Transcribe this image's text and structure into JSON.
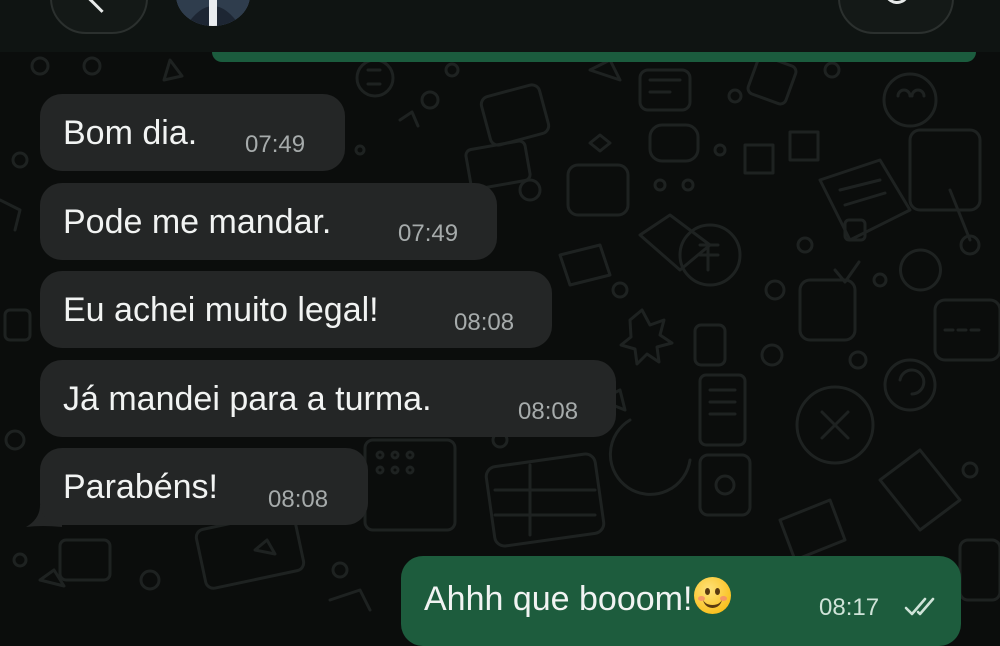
{
  "header": {
    "back_icon": "chevron-left-icon",
    "call_icon": "phone-icon"
  },
  "messages": [
    {
      "direction": "in",
      "text": "Bom dia.",
      "time": "07:49"
    },
    {
      "direction": "in",
      "text": "Pode me mandar.",
      "time": "07:49"
    },
    {
      "direction": "in",
      "text": "Eu achei muito legal!",
      "time": "08:08"
    },
    {
      "direction": "in",
      "text": "Já mandei para a turma.",
      "time": "08:08"
    },
    {
      "direction": "in",
      "text": "Parabéns!",
      "time": "08:08"
    },
    {
      "direction": "out",
      "text": "Ahhh que booom!",
      "emoji": "smiling-face-emoji",
      "time": "08:17",
      "status": "read-double-check"
    }
  ],
  "colors": {
    "background": "#0b0d0c",
    "incoming_bubble": "#242626",
    "outgoing_bubble": "#1d5c3d",
    "accent": "#1b5c3e"
  }
}
